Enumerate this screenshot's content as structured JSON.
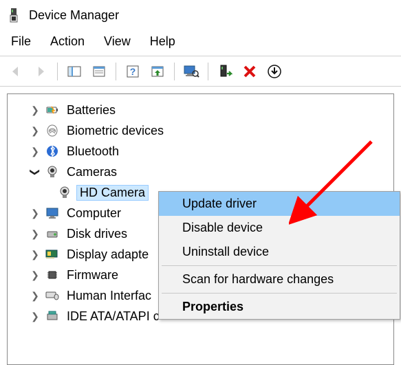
{
  "window": {
    "title": "Device Manager"
  },
  "menubar": {
    "file": "File",
    "action": "Action",
    "view": "View",
    "help": "Help"
  },
  "toolbar": {
    "back": "back-icon",
    "forward": "forward-icon",
    "showhide": "showhide-icon",
    "refresh": "refresh-icon",
    "help": "help-icon",
    "update": "update-icon",
    "scan": "scan-icon",
    "addlegacy": "addlegacy-icon",
    "remove": "remove-icon",
    "uninstall": "uninstall-icon"
  },
  "tree": {
    "items": [
      {
        "label": "Batteries",
        "expanded": false,
        "icon": "battery-icon"
      },
      {
        "label": "Biometric devices",
        "expanded": false,
        "icon": "fingerprint-icon"
      },
      {
        "label": "Bluetooth",
        "expanded": false,
        "icon": "bluetooth-icon"
      },
      {
        "label": "Cameras",
        "expanded": true,
        "icon": "camera-icon",
        "children": [
          {
            "label": "HD Camera",
            "icon": "camera-icon",
            "selected": true
          }
        ]
      },
      {
        "label": "Computer",
        "expanded": false,
        "icon": "monitor-icon"
      },
      {
        "label": "Disk drives",
        "expanded": false,
        "icon": "disk-icon"
      },
      {
        "label": "Display adapte",
        "expanded": false,
        "icon": "gpu-icon"
      },
      {
        "label": "Firmware",
        "expanded": false,
        "icon": "chip-icon"
      },
      {
        "label": "Human Interfac",
        "expanded": false,
        "icon": "hid-icon"
      },
      {
        "label": "IDE ATA/ATAPI c",
        "expanded": false,
        "icon": "ide-icon"
      }
    ]
  },
  "contextmenu": {
    "items": [
      {
        "label": "Update driver",
        "hovered": true
      },
      {
        "label": "Disable device"
      },
      {
        "label": "Uninstall device"
      },
      {
        "sep": true
      },
      {
        "label": "Scan for hardware changes"
      },
      {
        "sep": true
      },
      {
        "label": "Properties",
        "bold": true
      }
    ]
  }
}
